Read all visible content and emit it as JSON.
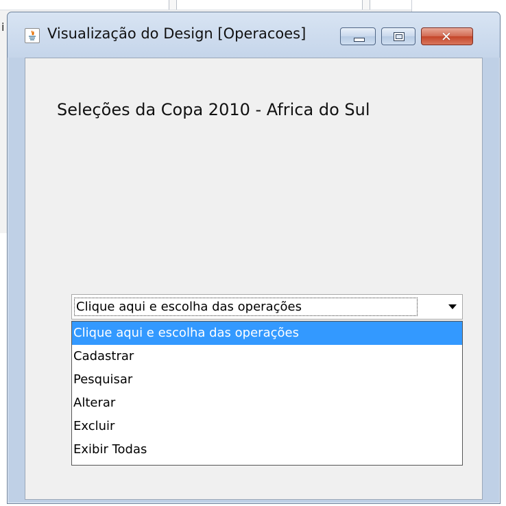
{
  "window": {
    "title": "Visualização do Design [Operacoes]",
    "close_symbol": "✕"
  },
  "background": {
    "partial_letter": "i"
  },
  "content": {
    "heading": "Seleções da Copa 2010 - Africa do Sul"
  },
  "combo": {
    "selected": "Clique aqui e escolha das operações",
    "options": [
      "Clique aqui e escolha das operações",
      "Cadastrar",
      "Pesquisar",
      "Alterar",
      "Excluir",
      "Exibir Todas"
    ],
    "highlighted_index": 0
  },
  "colors": {
    "selection": "#3399ff",
    "close_button": "#c44529",
    "client_background": "#f0f0f0"
  },
  "icons": {
    "app": "java-icon",
    "minimize": "minimize-icon",
    "maximize": "maximize-icon",
    "close": "close-icon",
    "dropdown": "chevron-down-icon"
  }
}
